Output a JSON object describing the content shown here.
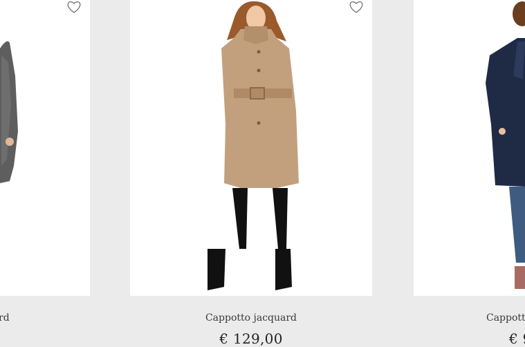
{
  "products": [
    {
      "name": "Cappotto jacquard",
      "visible_name": "rd",
      "price": "",
      "coat_color": "#6b6b6b"
    },
    {
      "name": "Cappotto jacquard",
      "price": "€ 129,00",
      "coat_color": "#c2a07e"
    },
    {
      "name": "Cappotto",
      "visible_name": "Cappotto",
      "visible_price": "€ 9",
      "coat_color": "#1f2a45"
    }
  ],
  "icons": {
    "wishlist": "heart-outline-icon"
  },
  "colors": {
    "page_bg": "#ebebeb",
    "card_bg": "#ffffff",
    "text": "#3a3a3a"
  }
}
